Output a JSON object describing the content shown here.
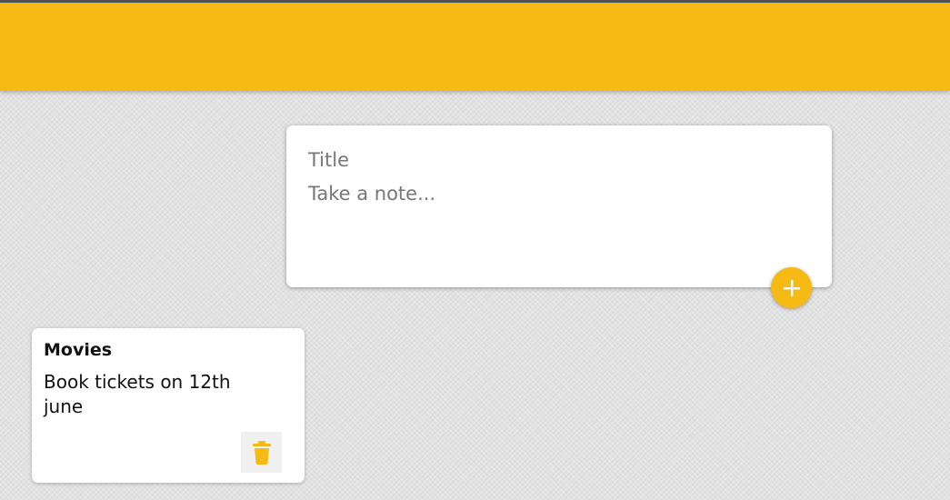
{
  "colors": {
    "accent": "#f5ba13",
    "header_border": "#4f5355",
    "background": "#e2e2e2",
    "card": "#ffffff"
  },
  "compose": {
    "title_placeholder": "Title",
    "content_placeholder": "Take a note...",
    "add_icon": "plus-icon"
  },
  "notes": [
    {
      "title": "Movies",
      "content": "Book tickets on 12th june",
      "delete_icon": "trash-icon"
    }
  ]
}
